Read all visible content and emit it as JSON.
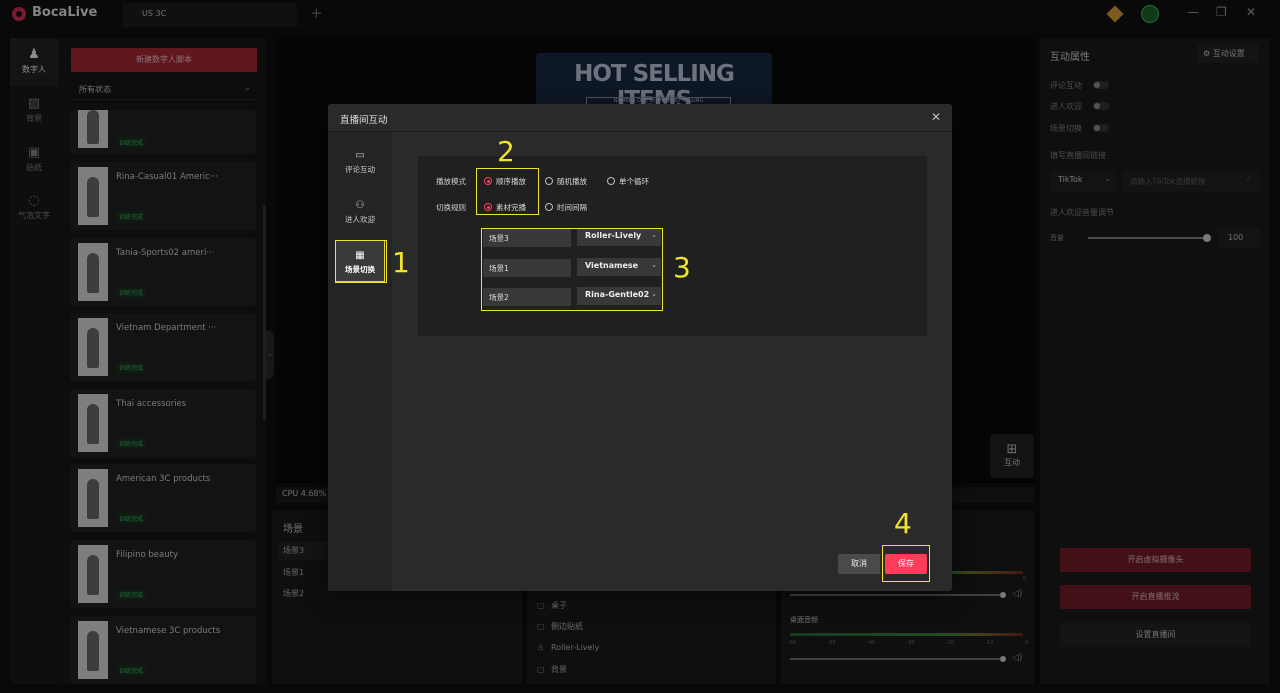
{
  "app": {
    "name": "BocaLive",
    "tab": "US 3C",
    "new_tab": "+"
  },
  "window_controls": {
    "minimize": "—",
    "maximize": "❐",
    "close": "✕"
  },
  "rail": [
    {
      "label": "数字人",
      "icon": "person-icon"
    },
    {
      "label": "背景",
      "icon": "background-icon"
    },
    {
      "label": "贴纸",
      "icon": "sticker-icon"
    },
    {
      "label": "气泡文字",
      "icon": "bubble-text-icon"
    }
  ],
  "list": {
    "new_button": "新建数字人脚本",
    "status_filter": "所有状态",
    "badge": "训练完成",
    "items": [
      {
        "name": ""
      },
      {
        "name": "Rina-Casual01 Americ···"
      },
      {
        "name": "Tania-Sports02 ameri···"
      },
      {
        "name": "Vietnam Department ···"
      },
      {
        "name": "Thai accessories"
      },
      {
        "name": "American 3C products"
      },
      {
        "name": "Filipino beauty"
      },
      {
        "name": "Vietnamese 3C products"
      }
    ]
  },
  "preview": {
    "poster_title": "HOT SELLING ITEMS",
    "poster_sub": "NUMBER ONE IN THE BEST SELLING",
    "interact_button": "互动",
    "cpu": "CPU 4.68%"
  },
  "scenes": {
    "title": "场景",
    "items": [
      "场景3",
      "场景1",
      "场景2"
    ]
  },
  "layers": {
    "items": [
      "桌子",
      "侧边贴纸",
      "Roller-Lively",
      "背景"
    ]
  },
  "audio": {
    "scale": [
      "-60",
      "-50",
      "-40",
      "-30",
      "-20",
      "-10",
      "0"
    ],
    "desktop_label": "桌面音频"
  },
  "right_panel": {
    "title": "互动属性",
    "settings_button": "互动设置",
    "toggles": [
      "评论互动",
      "进人欢迎",
      "场景切换"
    ],
    "link_label": "填写直播间链接",
    "platform": "TikTok",
    "link_placeholder": "请输入TikTok直播链接",
    "volume_label": "进人欢迎音量调节",
    "volume_name": "音量",
    "volume_value": "100"
  },
  "actions": [
    "开启虚拟摄像头",
    "开启直播推流",
    "设置直播间"
  ],
  "modal": {
    "title": "直播间互动",
    "tabs": [
      "评论互动",
      "进人欢迎",
      "场景切换"
    ],
    "play_mode_label": "播放模式",
    "play_modes": [
      "顺序播放",
      "随机播放",
      "单个循环"
    ],
    "switch_rule_label": "切换规则",
    "switch_rules": [
      "素材完播",
      "时间间隔"
    ],
    "rows": [
      {
        "scene": "场景3",
        "material": "Roller-Lively"
      },
      {
        "scene": "场景1",
        "material": "Vietnamese"
      },
      {
        "scene": "场景2",
        "material": "Rina-Gentle02"
      }
    ],
    "cancel": "取消",
    "save": "保存"
  },
  "annotations": [
    "1",
    "2",
    "3",
    "4"
  ],
  "colors": {
    "accent": "#ff3d5a",
    "highlight": "#f0e32d",
    "success": "#42c16a"
  }
}
